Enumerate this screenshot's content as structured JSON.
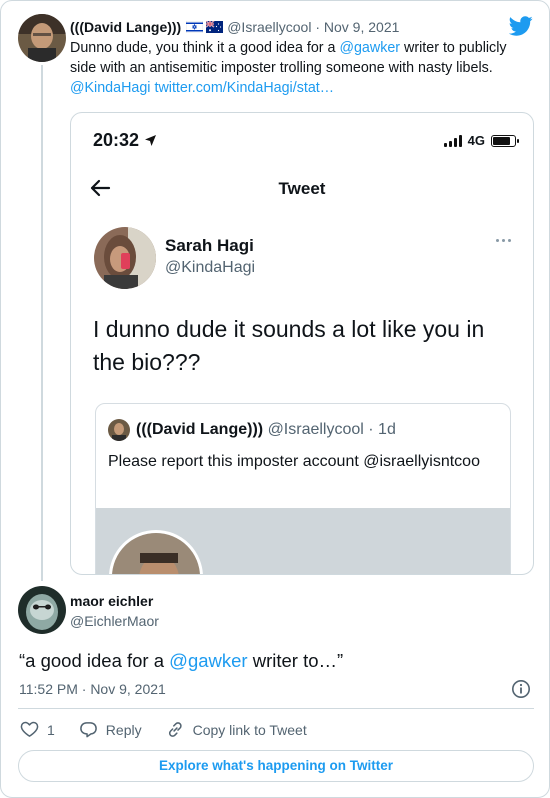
{
  "parent_tweet": {
    "author_name": "(((David Lange)))",
    "flags": [
      "israel-flag",
      "australia-flag"
    ],
    "handle_date": "@Israellycool · Nov 9, 2021",
    "text_before": "Dunno dude, you think it a good idea for a ",
    "mention": "@gawker",
    "text_after": " writer to publicly side with an antisemitic imposter trolling someone with nasty libels.",
    "link_mention": "@KindaHagi",
    "link_url": "twitter.com/KindaHagi/stat…"
  },
  "embedded_screenshot": {
    "status_time": "20:32",
    "network": "4G",
    "screen_title": "Tweet",
    "author_name": "Sarah Hagi",
    "author_handle": "@KindaHagi",
    "text": "I dunno dude it sounds a lot like you in the bio???",
    "quoted": {
      "author_name": "(((David Lange)))",
      "handle_date": "@Israellycool · 1d",
      "text": "Please report this imposter account @israellyisntcoo"
    }
  },
  "tweet": {
    "author_name": "maor eichler",
    "author_handle": "@EichlerMaor",
    "text_before": "“a good idea for a ",
    "mention": "@gawker",
    "text_after": " writer to…”",
    "timestamp": "11:52 PM · Nov 9, 2021"
  },
  "actions": {
    "like_count": "1",
    "reply_label": "Reply",
    "copy_link_label": "Copy link to Tweet"
  },
  "explore_label": "Explore what's happening on Twitter",
  "colors": {
    "accent": "#1d9bf0",
    "text": "#0f1419",
    "secondary": "#536471",
    "border": "#cfd9de"
  }
}
